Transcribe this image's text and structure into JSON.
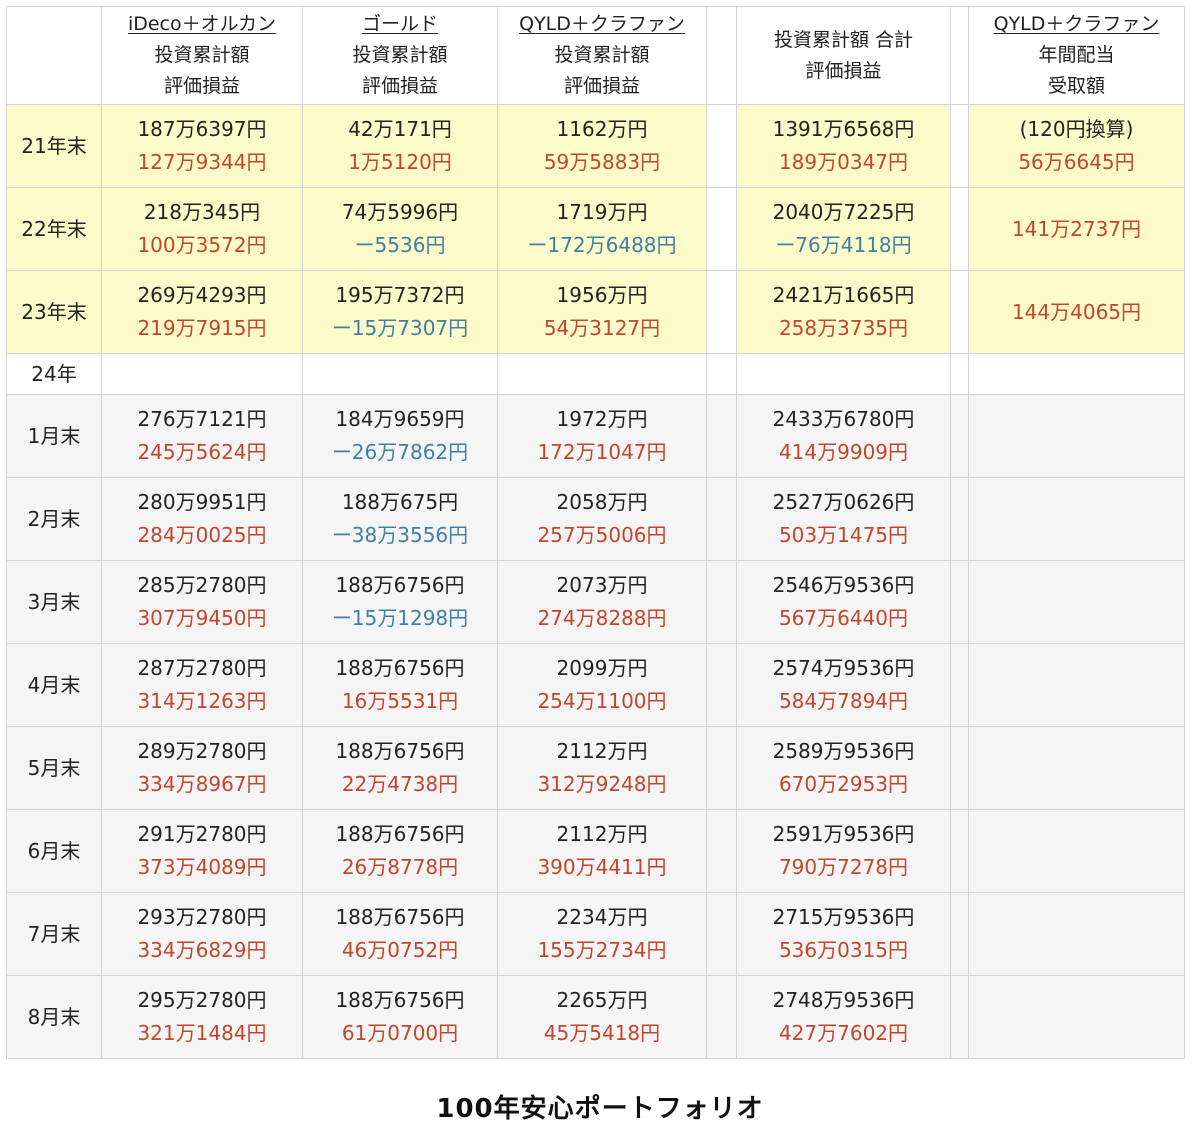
{
  "headers": {
    "c1": [
      "iDeco＋オルカン",
      "投資累計額",
      "評価損益"
    ],
    "c2": [
      "ゴールド",
      "投資累計額",
      "評価損益"
    ],
    "c3": [
      "QYLD＋クラファン",
      "投資累計額",
      "評価損益"
    ],
    "c4": [
      "投資累計額 合計",
      "評価損益"
    ],
    "c5": [
      "QYLD＋クラファン",
      "年間配当",
      "受取額"
    ]
  },
  "year_rows": [
    {
      "label": "21年末",
      "c1": [
        "187万6397円",
        "127万9344円"
      ],
      "c2": [
        "42万171円",
        "1万5120円"
      ],
      "c3": [
        "1162万円",
        "59万5883円"
      ],
      "c4": [
        "1391万6568円",
        "189万0347円"
      ],
      "c5": [
        "(120円換算)",
        "56万6645円"
      ]
    },
    {
      "label": "22年末",
      "c1": [
        "218万345円",
        "100万3572円"
      ],
      "c2": [
        "74万5996円",
        "ー5536円"
      ],
      "c3": [
        "1719万円",
        "ー172万6488円"
      ],
      "c4": [
        "2040万7225円",
        "ー76万4118円"
      ],
      "c5": [
        "141万2737円"
      ]
    },
    {
      "label": "23年末",
      "c1": [
        "269万4293円",
        "219万7915円"
      ],
      "c2": [
        "195万7372円",
        "ー15万7307円"
      ],
      "c3": [
        "1956万円",
        "54万3127円"
      ],
      "c4": [
        "2421万1665円",
        "258万3735円"
      ],
      "c5": [
        "144万4065円"
      ]
    }
  ],
  "year_label_2024": "24年",
  "month_rows": [
    {
      "label": "1月末",
      "c1": [
        "276万7121円",
        "245万5624円"
      ],
      "c2": [
        "184万9659円",
        "ー26万7862円"
      ],
      "c3": [
        "1972万円",
        "172万1047円"
      ],
      "c4": [
        "2433万6780円",
        "414万9909円"
      ]
    },
    {
      "label": "2月末",
      "c1": [
        "280万9951円",
        "284万0025円"
      ],
      "c2": [
        "188万675円",
        "ー38万3556円"
      ],
      "c3": [
        "2058万円",
        "257万5006円"
      ],
      "c4": [
        "2527万0626円",
        "503万1475円"
      ]
    },
    {
      "label": "3月末",
      "c1": [
        "285万2780円",
        "307万9450円"
      ],
      "c2": [
        "188万6756円",
        "ー15万1298円"
      ],
      "c3": [
        "2073万円",
        "274万8288円"
      ],
      "c4": [
        "2546万9536円",
        "567万6440円"
      ]
    },
    {
      "label": "4月末",
      "c1": [
        "287万2780円",
        "314万1263円"
      ],
      "c2": [
        "188万6756円",
        "16万5531円"
      ],
      "c3": [
        "2099万円",
        "254万1100円"
      ],
      "c4": [
        "2574万9536円",
        "584万7894円"
      ]
    },
    {
      "label": "5月末",
      "c1": [
        "289万2780円",
        "334万8967円"
      ],
      "c2": [
        "188万6756円",
        "22万4738円"
      ],
      "c3": [
        "2112万円",
        "312万9248円"
      ],
      "c4": [
        "2589万9536円",
        "670万2953円"
      ]
    },
    {
      "label": "6月末",
      "c1": [
        "291万2780円",
        "373万4089円"
      ],
      "c2": [
        "188万6756円",
        "26万8778円"
      ],
      "c3": [
        "2112万円",
        "390万4411円"
      ],
      "c4": [
        "2591万9536円",
        "790万7278円"
      ]
    },
    {
      "label": "7月末",
      "c1": [
        "293万2780円",
        "334万6829円"
      ],
      "c2": [
        "188万6756円",
        "46万0752円"
      ],
      "c3": [
        "2234万円",
        "155万2734円"
      ],
      "c4": [
        "2715万9536円",
        "536万0315円"
      ]
    },
    {
      "label": "8月末",
      "c1": [
        "295万2780円",
        "321万1484円"
      ],
      "c2": [
        "188万6756円",
        "61万0700円"
      ],
      "c3": [
        "2265万円",
        "45万5418円"
      ],
      "c4": [
        "2748万9536円",
        "427万7602円"
      ]
    }
  ],
  "colors": {
    "positive": "#c4452b",
    "negative": "#3f7fa6",
    "year_highlight": "#fdfbc9",
    "month_row": "#f5f5f5"
  },
  "caption": "100年安心ポートフォリオ"
}
